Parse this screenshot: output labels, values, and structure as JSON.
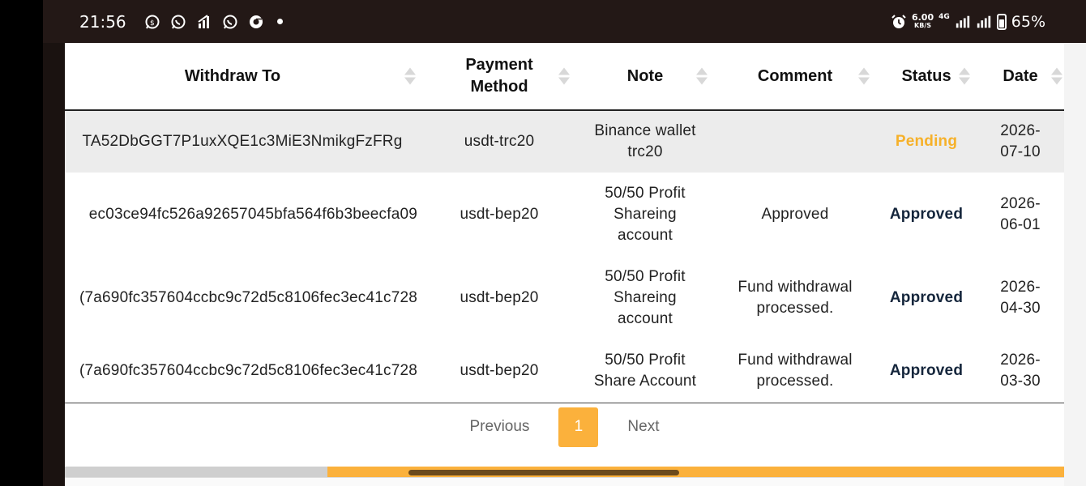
{
  "statusbar": {
    "time": "21:56",
    "speed_value": "6.00",
    "speed_unit": "KB/S",
    "net": "4G",
    "battery": "65%"
  },
  "table": {
    "headers": {
      "withdraw_to": "Withdraw To",
      "payment_method_1": "Payment",
      "payment_method_2": "Method",
      "note": "Note",
      "comment": "Comment",
      "status": "Status",
      "date": "Date"
    },
    "rows": [
      {
        "withdraw_to": "TA52DbGGT7P1uxXQE1c3MiE3NmikgFzFRg",
        "payment_method": "usdt-trc20",
        "note_1": "Binance wallet",
        "note_2": "trc20",
        "note_3": "",
        "comment_1": "",
        "comment_2": "",
        "status": "Pending",
        "date_1": "2026-",
        "date_2": "07-10"
      },
      {
        "withdraw_to": "ec03ce94fc526a92657045bfa564f6b3beecfa09",
        "payment_method": "usdt-bep20",
        "note_1": "50/50 Profit",
        "note_2": "Shareing",
        "note_3": "account",
        "comment_1": "Approved",
        "comment_2": "",
        "status": "Approved",
        "date_1": "2026-",
        "date_2": "06-01"
      },
      {
        "withdraw_to": "(7a690fc357604ccbc9c72d5c8106fec3ec41c728",
        "payment_method": "usdt-bep20",
        "note_1": "50/50 Profit",
        "note_2": "Shareing",
        "note_3": "account",
        "comment_1": "Fund withdrawal",
        "comment_2": "processed.",
        "status": "Approved",
        "date_1": "2026-",
        "date_2": "04-30"
      },
      {
        "withdraw_to": "(7a690fc357604ccbc9c72d5c8106fec3ec41c728",
        "payment_method": "usdt-bep20",
        "note_1": "50/50 Profit",
        "note_2": "Share Account",
        "note_3": "",
        "comment_1": "Fund withdrawal",
        "comment_2": "processed.",
        "status": "Approved",
        "date_1": "2026-",
        "date_2": "03-30"
      }
    ]
  },
  "pagination": {
    "previous": "Previous",
    "current": "1",
    "next": "Next"
  },
  "colors": {
    "accent": "#fbb13c",
    "pending": "#f6b12a",
    "approved": "#15263c"
  }
}
